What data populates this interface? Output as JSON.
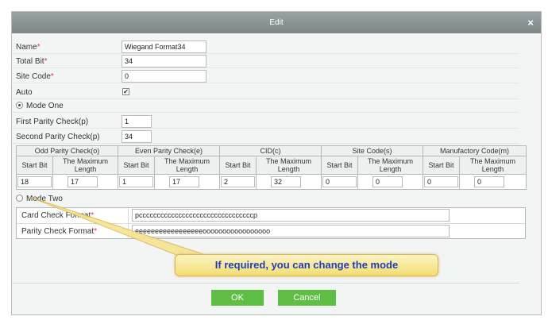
{
  "dialog": {
    "title": "Edit",
    "close_symbol": "×"
  },
  "form": {
    "name": {
      "label": "Name",
      "value": "Wiegand Format34"
    },
    "total_bit": {
      "label": "Total Bit",
      "value": "34"
    },
    "site_code": {
      "label": "Site Code",
      "value": "0"
    },
    "auto": {
      "label": "Auto",
      "checked": true,
      "mark": "✔"
    },
    "mode_one": {
      "label": "Mode One",
      "selected": true
    },
    "first_parity": {
      "label": "First Parity Check(p)",
      "value": "1"
    },
    "second_parity": {
      "label": "Second Parity Check(p)",
      "value": "34"
    },
    "required_mark": "*"
  },
  "parity_table": {
    "groups": [
      "Odd Parity Check(o)",
      "Even Parity Check(e)",
      "CID(c)",
      "Site Code(s)",
      "Manufactory Code(m)"
    ],
    "sub_headers": {
      "start": "Start Bit",
      "length": "The Maximum Length"
    },
    "values": [
      {
        "start": "18",
        "length": "17"
      },
      {
        "start": "1",
        "length": "17"
      },
      {
        "start": "2",
        "length": "32"
      },
      {
        "start": "0",
        "length": "0"
      },
      {
        "start": "0",
        "length": "0"
      }
    ]
  },
  "mode_two": {
    "label": "Mode Two",
    "selected": false,
    "card_check_format": {
      "label": "Card Check Format",
      "value": "pccccccccccccccccccccccccccccccccp"
    },
    "parity_check_format": {
      "label": "Parity Check Format",
      "value": "eeeeeeeeeeeeeeeeeooooooooooooooooo"
    }
  },
  "callout": {
    "text": "If required, you can change the mode"
  },
  "buttons": {
    "ok": "OK",
    "cancel": "Cancel"
  },
  "colors": {
    "button": "#5fbf45",
    "required": "#e23b3b",
    "callout_text": "#1d3fb5",
    "titlebar": "#8c9596"
  }
}
